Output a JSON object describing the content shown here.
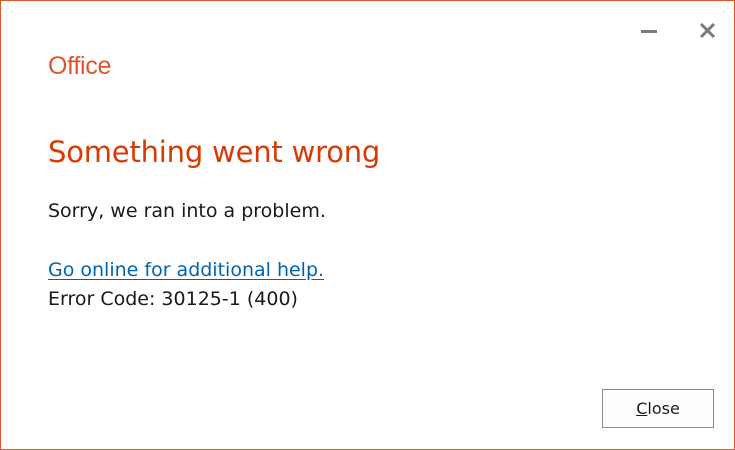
{
  "window": {
    "border_color": "#d9572b",
    "titlebar": {
      "minimize_icon": "minimize-icon",
      "close_icon": "close-icon",
      "icon_color": "#7a7a7a"
    }
  },
  "brand": {
    "logo_text": "Office",
    "color": "#e0542b"
  },
  "dialog": {
    "heading": "Something went wrong",
    "heading_color": "#d83b01",
    "message": "Sorry, we ran into a problem.",
    "help_link_text": "Go online for additional help.",
    "link_color": "#0063b1",
    "error_code": "Error Code: 30125-1 (400)"
  },
  "buttons": {
    "close_label": "Close",
    "close_accelerator": "C",
    "close_rest": "lose"
  }
}
